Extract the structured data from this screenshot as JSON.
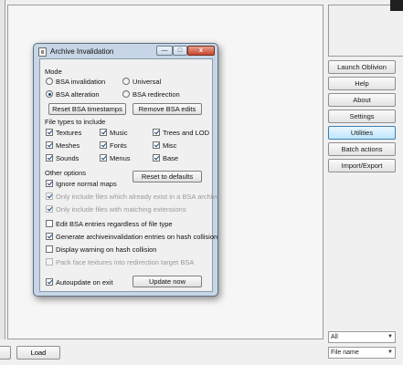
{
  "dialog": {
    "title": "Archive Invalidation",
    "caption_buttons": {
      "minimize": "—",
      "maximize": "□",
      "close": "x"
    },
    "mode": {
      "label": "Mode",
      "options": [
        "BSA invalidation",
        "Universal",
        "BSA alteration",
        "BSA redirection"
      ],
      "selected": "BSA alteration"
    },
    "reset_timestamps_label": "Reset BSA timestamps",
    "remove_edits_label": "Remove BSA edits",
    "file_types": {
      "label": "File types to include",
      "items": [
        {
          "label": "Textures",
          "checked": true
        },
        {
          "label": "Music",
          "checked": true
        },
        {
          "label": "Trees and LOD",
          "checked": true
        },
        {
          "label": "Meshes",
          "checked": true
        },
        {
          "label": "Fonts",
          "checked": true
        },
        {
          "label": "Misc",
          "checked": true
        },
        {
          "label": "Sounds",
          "checked": true
        },
        {
          "label": "Menus",
          "checked": true
        },
        {
          "label": "Base",
          "checked": true
        }
      ]
    },
    "other_options": {
      "label": "Other options",
      "reset_defaults_label": "Reset to defaults",
      "items": [
        {
          "label": "Ignore normal maps",
          "checked": true,
          "enabled": true
        },
        {
          "label": "Only include files which already exist in a BSA archive",
          "checked": true,
          "enabled": false
        },
        {
          "label": "Only include files with matching extensions",
          "checked": true,
          "enabled": false
        },
        {
          "label": "Edit BSA entries regardless of file type",
          "checked": false,
          "enabled": true
        },
        {
          "label": "Generate archiveinvalidation entries on hash collision",
          "checked": true,
          "enabled": true
        },
        {
          "label": "Display warning on hash collision",
          "checked": false,
          "enabled": true
        },
        {
          "label": "Pack face textures into redirection target BSA",
          "checked": false,
          "enabled": false
        }
      ]
    },
    "autoupdate": {
      "label": "Autoupdate on exit",
      "checked": true
    },
    "update_now_label": "Update now"
  },
  "sidebar": {
    "buttons": [
      "Launch Oblivion",
      "Help",
      "About",
      "Settings",
      "Utilities",
      "Batch actions",
      "Import/Export"
    ],
    "active": "Utilities"
  },
  "filters": {
    "filter_value": "All",
    "sort_value": "File name"
  },
  "bottom_bar": {
    "load_label": "Load"
  }
}
